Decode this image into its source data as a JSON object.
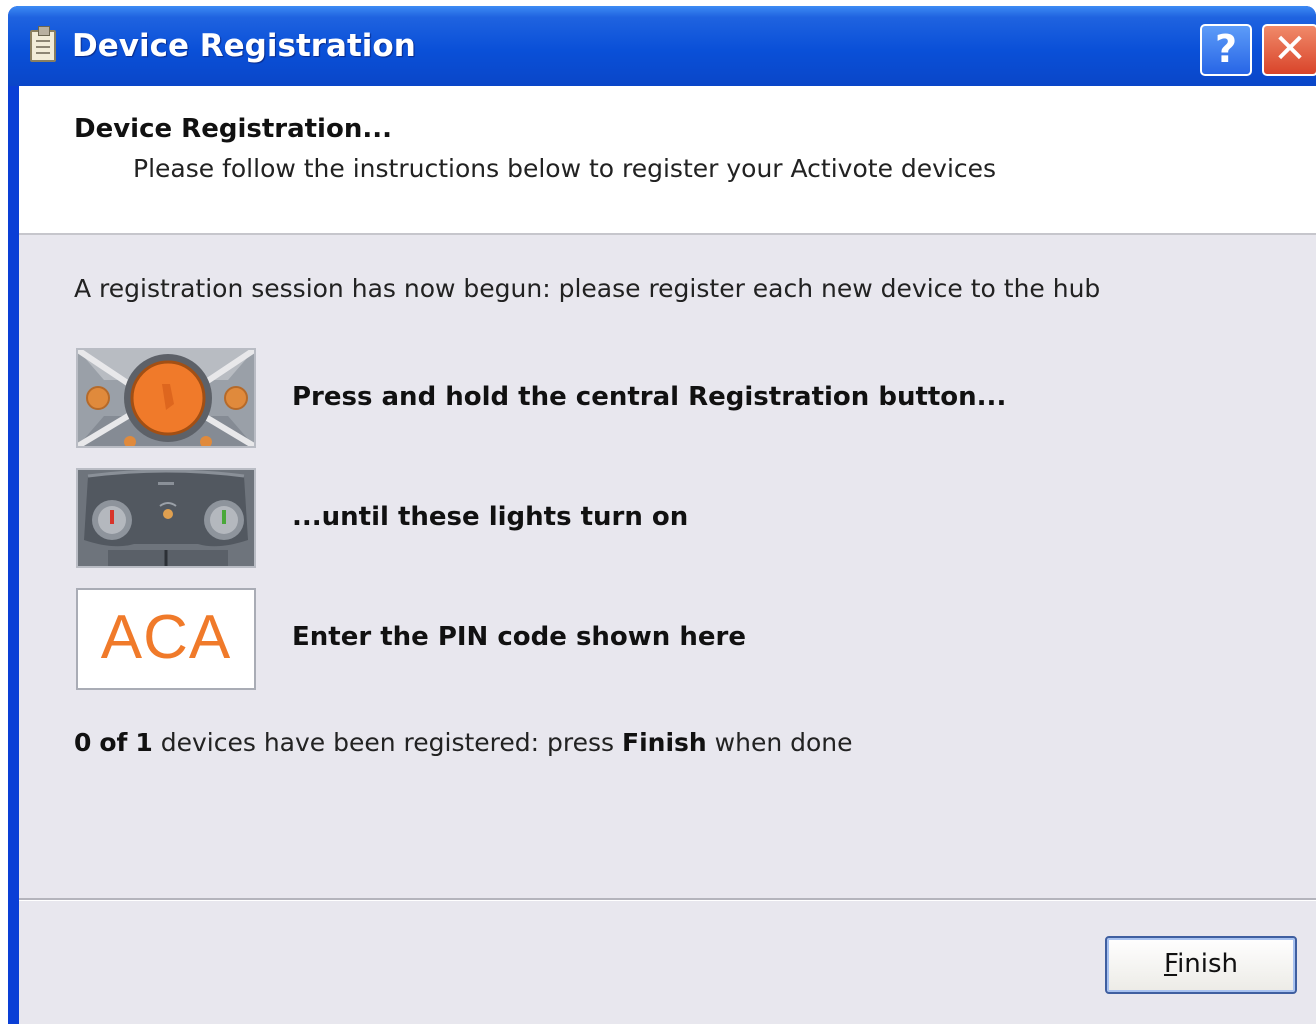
{
  "window": {
    "title": "Device Registration",
    "help_glyph": "?",
    "close_glyph": "✕",
    "title_icon": "clipboard-icon"
  },
  "header": {
    "title": "Device Registration...",
    "subtitle": "Please follow the instructions below to register your Activote devices"
  },
  "body": {
    "intro": "A registration session has now begun: please register each new device to the hub",
    "steps": [
      {
        "image": "device-registration-button-image",
        "text": "Press and hold the central Registration button..."
      },
      {
        "image": "device-lights-image",
        "text": "...until these lights turn on"
      },
      {
        "image": "pin-code-display",
        "text": "Enter the PIN code shown here"
      }
    ],
    "pin_code": "ACA",
    "status": {
      "registered": "0",
      "of_word": "of",
      "total": "1",
      "text_1": "devices have been registered: press",
      "finish_word": "Finish",
      "text_2": "when done"
    }
  },
  "footer": {
    "finish_mnemonic": "F",
    "finish_rest": "inish"
  },
  "colors": {
    "titlebar": "#0a50d8",
    "client_bg": "#e8e7ee",
    "pin_orange": "#f07a2a"
  }
}
